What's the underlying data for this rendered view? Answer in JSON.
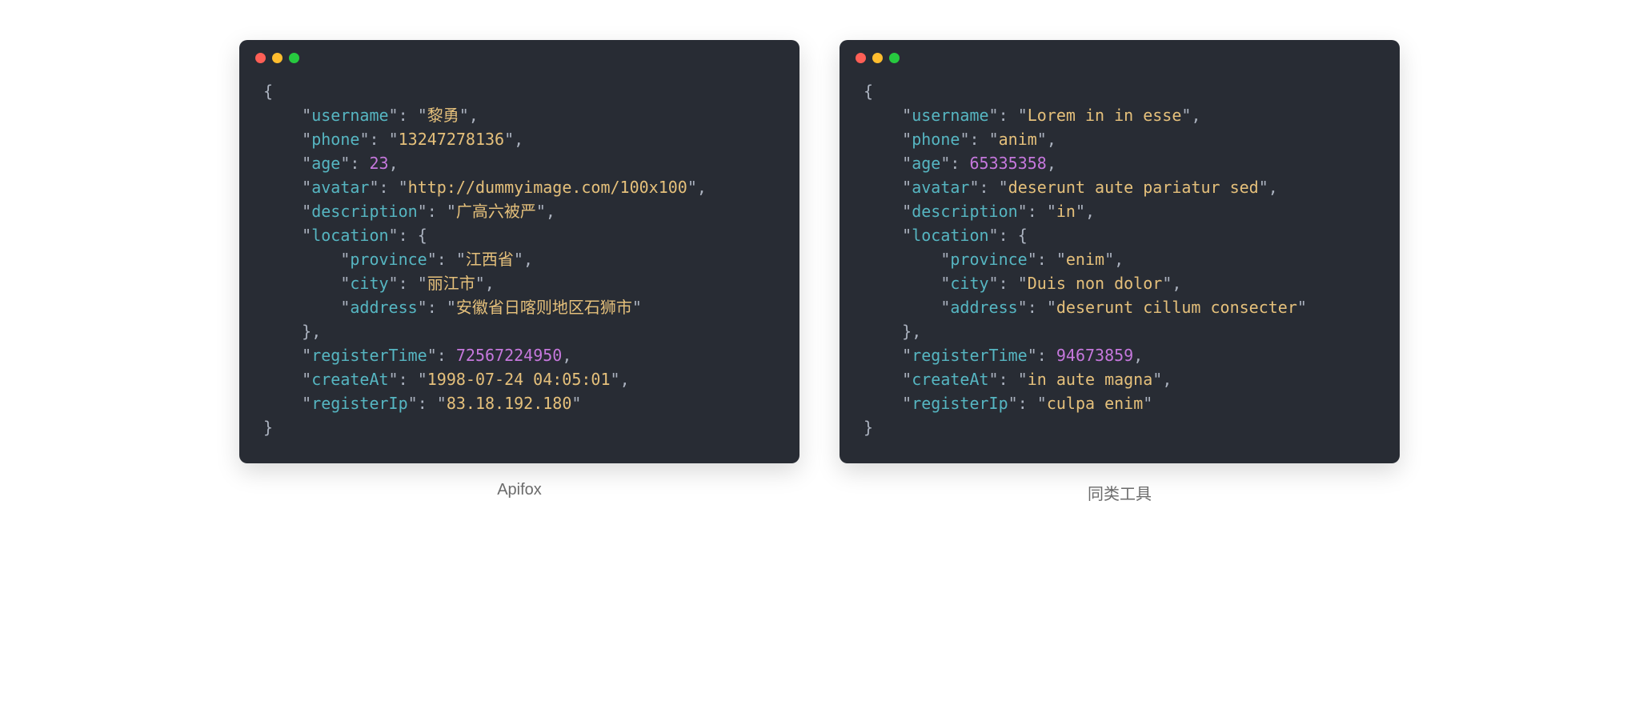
{
  "left": {
    "caption": "Apifox",
    "json": {
      "username": "黎勇",
      "phone": "13247278136",
      "age": 23,
      "avatar": "http://dummyimage.com/100x100",
      "description": "广高六被严",
      "location": {
        "province": "江西省",
        "city": "丽江市",
        "address": "安徽省日喀则地区石狮市"
      },
      "registerTime": 72567224950,
      "createAt": "1998-07-24 04:05:01",
      "registerIp": "83.18.192.180"
    }
  },
  "right": {
    "caption": "同类工具",
    "json": {
      "username": "Lorem in in esse",
      "phone": "anim",
      "age": 65335358,
      "avatar": "deserunt aute pariatur sed",
      "description": "in",
      "location": {
        "province": "enim",
        "city": "Duis non dolor",
        "address": "deserunt cillum consecter"
      },
      "registerTime": 94673859,
      "createAt": "in aute magna",
      "registerIp": "culpa enim"
    }
  }
}
